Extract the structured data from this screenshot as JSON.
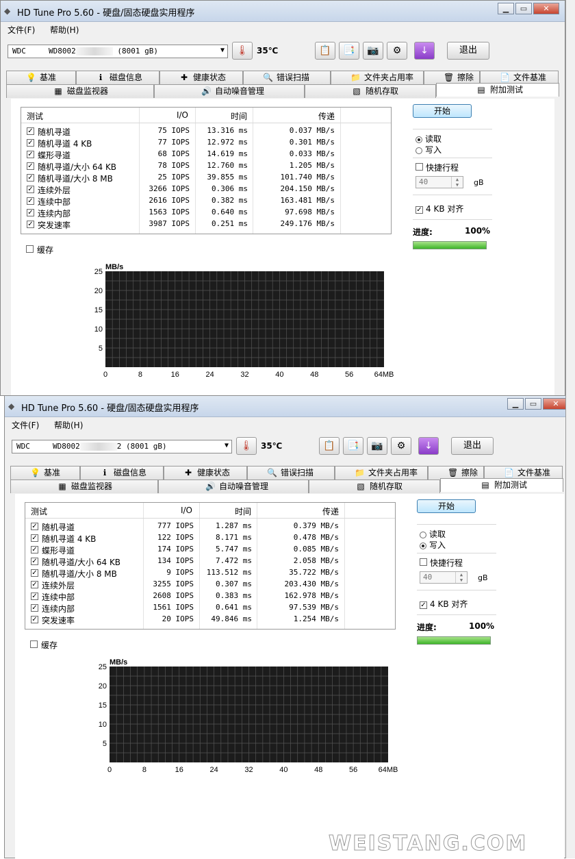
{
  "app": {
    "title": "HD Tune Pro 5.60 - 硬盘/固态硬盘实用程序",
    "menu": [
      "文件(F)",
      "帮助(H)"
    ],
    "temperature": "35℃",
    "exit_label": "退出"
  },
  "tabs_row1": [
    {
      "label": "基准",
      "icon": "benchmark-icon"
    },
    {
      "label": "磁盘信息",
      "icon": "info-icon"
    },
    {
      "label": "健康状态",
      "icon": "health-cross-icon"
    },
    {
      "label": "错误扫描",
      "icon": "magnifier-icon"
    },
    {
      "label": "文件夹占用率",
      "icon": "folder-icon"
    },
    {
      "label": "擦除",
      "icon": "trash-icon"
    },
    {
      "label": "文件基准",
      "icon": "file-benchmark-icon"
    }
  ],
  "tabs_row2": [
    {
      "label": "磁盘监视器",
      "icon": "monitor-chart-icon"
    },
    {
      "label": "自动噪音管理",
      "icon": "speaker-icon"
    },
    {
      "label": "随机存取",
      "icon": "random-access-icon"
    },
    {
      "label": "附加测试",
      "icon": "extra-tests-icon",
      "active": true
    }
  ],
  "grid_headers": [
    "测试",
    "I/O",
    "时间",
    "传递"
  ],
  "controls": {
    "start_label": "开始",
    "read_label": "读取",
    "write_label": "写入",
    "short_stroke_label": "快捷行程",
    "short_stroke_value": "40",
    "unit_gb": "gB",
    "align_label": "4 KB 对齐",
    "progress_label": "进度:",
    "progress_text": "100%",
    "progress_fraction": 1.0,
    "cache_label": "缓存"
  },
  "windows": [
    {
      "drive": {
        "prefix": "WDC     WD8002",
        "suffix": " (8001 gB)",
        "suffix_tail": "  "
      },
      "mode": "read",
      "rows": [
        {
          "test": "随机寻道",
          "io": "75 IOPS",
          "time": "13.316 ms",
          "rate": "0.037 MB/s"
        },
        {
          "test": "随机寻道 4 KB",
          "io": "77 IOPS",
          "time": "12.972 ms",
          "rate": "0.301 MB/s"
        },
        {
          "test": "蝶形寻道",
          "io": "68 IOPS",
          "time": "14.619 ms",
          "rate": "0.033 MB/s"
        },
        {
          "test": "随机寻道/大小 64 KB",
          "io": "78 IOPS",
          "time": "12.760 ms",
          "rate": "1.205 MB/s"
        },
        {
          "test": "随机寻道/大小 8 MB",
          "io": "25 IOPS",
          "time": "39.855 ms",
          "rate": "101.740 MB/s"
        },
        {
          "test": "连续外层",
          "io": "3266 IOPS",
          "time": "0.306 ms",
          "rate": "204.150 MB/s"
        },
        {
          "test": "连续中部",
          "io": "2616 IOPS",
          "time": "0.382 ms",
          "rate": "163.481 MB/s"
        },
        {
          "test": "连续内部",
          "io": "1563 IOPS",
          "time": "0.640 ms",
          "rate": "97.698 MB/s"
        },
        {
          "test": "突发速率",
          "io": "3987 IOPS",
          "time": "0.251 ms",
          "rate": "249.176 MB/s"
        }
      ]
    },
    {
      "drive": {
        "prefix": "WDC     WD8002",
        "suffix": "2 (8001 gB)",
        "suffix_tail": ""
      },
      "mode": "write",
      "rows": [
        {
          "test": "随机寻道",
          "io": "777 IOPS",
          "time": "1.287 ms",
          "rate": "0.379 MB/s"
        },
        {
          "test": "随机寻道 4 KB",
          "io": "122 IOPS",
          "time": "8.171 ms",
          "rate": "0.478 MB/s"
        },
        {
          "test": "蝶形寻道",
          "io": "174 IOPS",
          "time": "5.747 ms",
          "rate": "0.085 MB/s"
        },
        {
          "test": "随机寻道/大小 64 KB",
          "io": "134 IOPS",
          "time": "7.472 ms",
          "rate": "2.058 MB/s"
        },
        {
          "test": "随机寻道/大小 8 MB",
          "io": "9 IOPS",
          "time": "113.512 ms",
          "rate": "35.722 MB/s"
        },
        {
          "test": "连续外层",
          "io": "3255 IOPS",
          "time": "0.307 ms",
          "rate": "203.430 MB/s"
        },
        {
          "test": "连续中部",
          "io": "2608 IOPS",
          "time": "0.383 ms",
          "rate": "162.978 MB/s"
        },
        {
          "test": "连续内部",
          "io": "1561 IOPS",
          "time": "0.641 ms",
          "rate": "97.539 MB/s"
        },
        {
          "test": "突发速率",
          "io": "20 IOPS",
          "time": "49.846 ms",
          "rate": "1.254 MB/s"
        }
      ]
    }
  ],
  "chart_data": [
    {
      "type": "line",
      "ylabel": "MB/s",
      "xunit": "MB",
      "yticks": [
        "25",
        "20",
        "15",
        "10",
        "5"
      ],
      "xticks": [
        "0",
        "8",
        "16",
        "24",
        "32",
        "40",
        "48",
        "56",
        "64MB"
      ],
      "ylim": [
        0,
        25
      ],
      "xlim": [
        0,
        64
      ],
      "grid": true,
      "series": []
    },
    {
      "type": "line",
      "ylabel": "MB/s",
      "xunit": "MB",
      "yticks": [
        "25",
        "20",
        "15",
        "10",
        "5"
      ],
      "xticks": [
        "0",
        "8",
        "16",
        "24",
        "32",
        "40",
        "48",
        "56",
        "64MB"
      ],
      "ylim": [
        0,
        25
      ],
      "xlim": [
        0,
        64
      ],
      "grid": true,
      "series": []
    }
  ],
  "watermark": "WEISTANG.COM",
  "colors": {
    "chart_bg": "#1c1c1c",
    "chart_grid": "#555555",
    "progress": "#3eb52a",
    "start_btn": "#bee6fd"
  }
}
